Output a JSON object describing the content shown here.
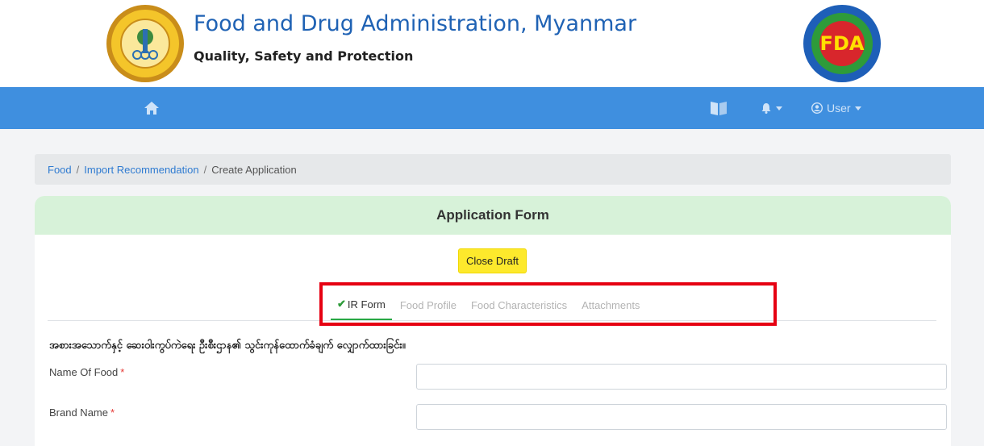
{
  "header": {
    "title": "Food and Drug Administration, Myanmar",
    "tagline": "Quality, Safety and Protection",
    "left_logo_icon": "ministry-of-health-seal",
    "right_logo_icon": "fda-seal",
    "right_logo_text": "FDA"
  },
  "navbar": {
    "home_icon": "home-icon",
    "book_icon": "book-icon",
    "bell_icon": "bell-icon",
    "user_label": "User",
    "bg_color": "#3f8fdf"
  },
  "breadcrumb": {
    "items": [
      "Food",
      "Import Recommendation",
      "Create Application"
    ]
  },
  "form": {
    "card_title": "Application Form",
    "close_draft_label": "Close Draft",
    "tabs": [
      "IR Form",
      "Food Profile",
      "Food Characteristics",
      "Attachments"
    ],
    "active_tab": "IR Form",
    "section_title": "အစားအသောက်နှင့် ဆေးဝါးကွပ်ကဲရေး ဦးစီးဌာန၏ သွင်းကုန်ထောက်ခံချက် လျှောက်ထားခြင်း။",
    "fields": [
      {
        "label": "Name Of Food",
        "required_mark": "*",
        "value": ""
      },
      {
        "label": "Brand Name",
        "required_mark": "*",
        "value": ""
      }
    ]
  }
}
